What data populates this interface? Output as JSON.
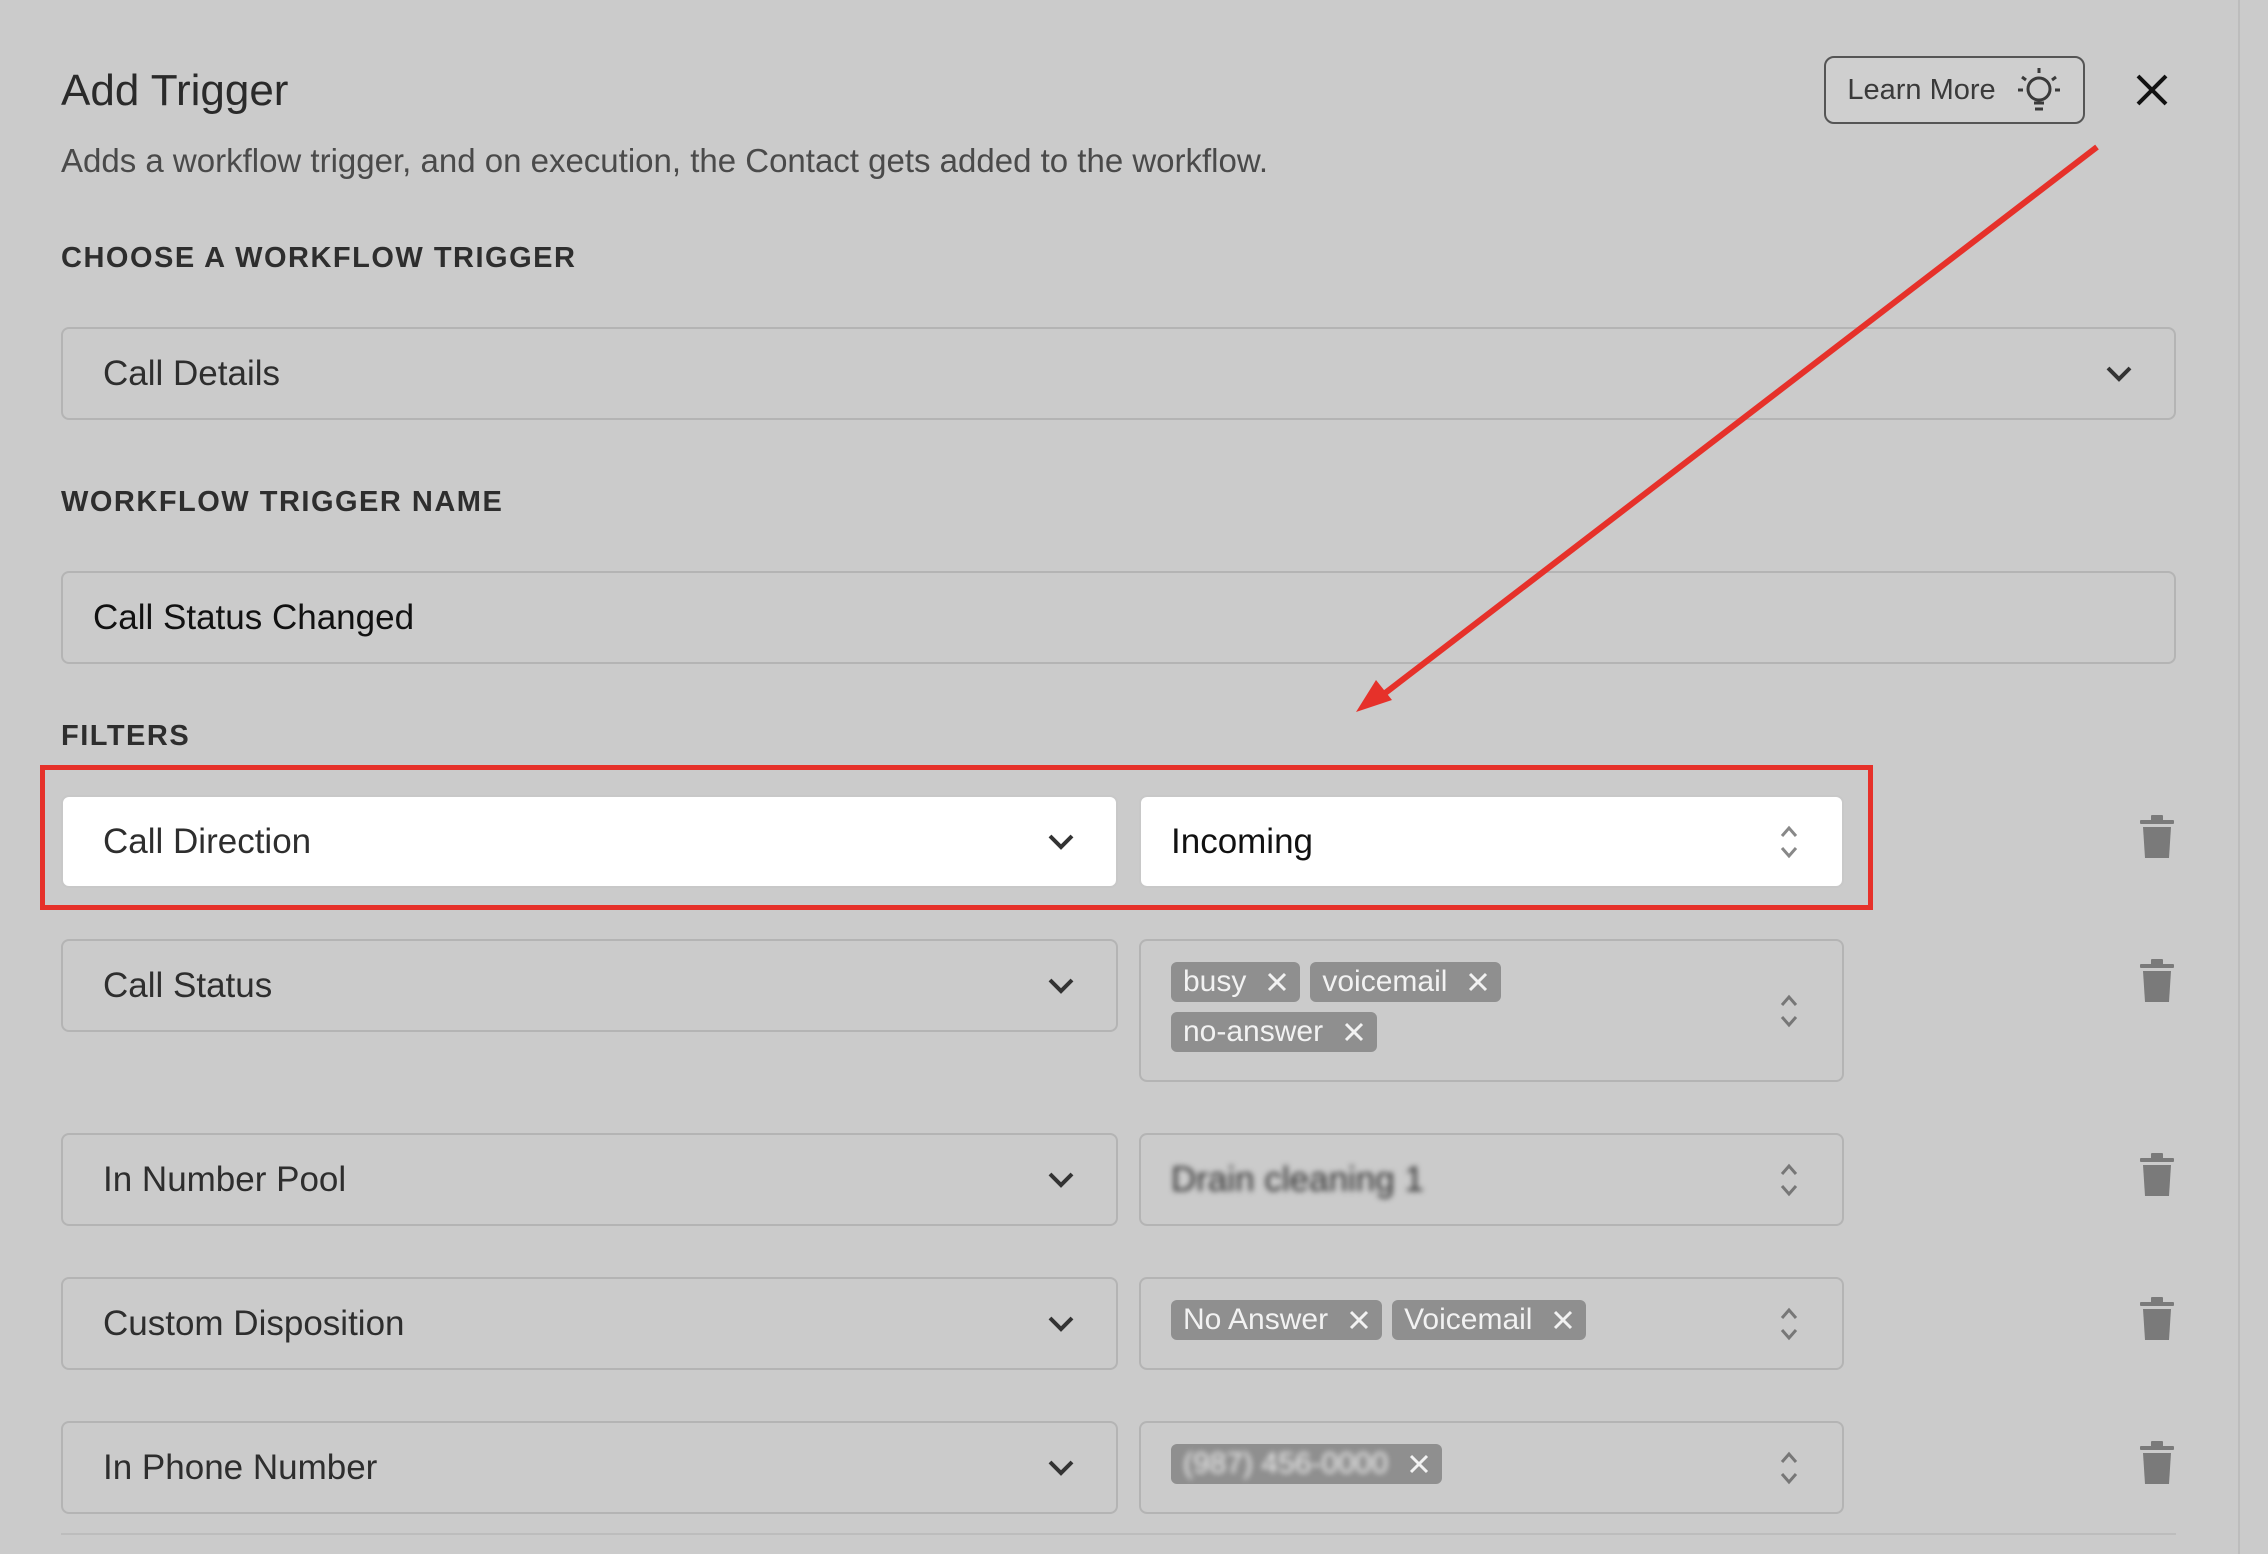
{
  "header": {
    "title": "Add Trigger",
    "subtitle": "Adds a workflow trigger, and on execution, the Contact gets added to the workflow.",
    "learn_more": "Learn More",
    "learn_more_icon": "lightbulb-icon",
    "close_icon": "close-icon"
  },
  "trigger": {
    "label": "CHOOSE A WORKFLOW TRIGGER",
    "selected": "Call Details"
  },
  "trigger_name": {
    "label": "WORKFLOW TRIGGER NAME",
    "value": "Call Status Changed"
  },
  "filters": {
    "label": "FILTERS",
    "rows": [
      {
        "field": "Call Direction",
        "value": "Incoming"
      },
      {
        "field": "Call Status",
        "chips": [
          "busy",
          "voicemail",
          "no-answer"
        ]
      },
      {
        "field": "In Number Pool",
        "value": "Drain cleaning 1"
      },
      {
        "field": "Custom Disposition",
        "chips": [
          "No Answer",
          "Voicemail"
        ]
      },
      {
        "field": "In Phone Number",
        "chips": [
          "(987) 456-0000"
        ]
      }
    ]
  },
  "colors": {
    "background": "#cbcbcb",
    "highlight": "#e6312a",
    "chip": "#8f8f8f"
  }
}
